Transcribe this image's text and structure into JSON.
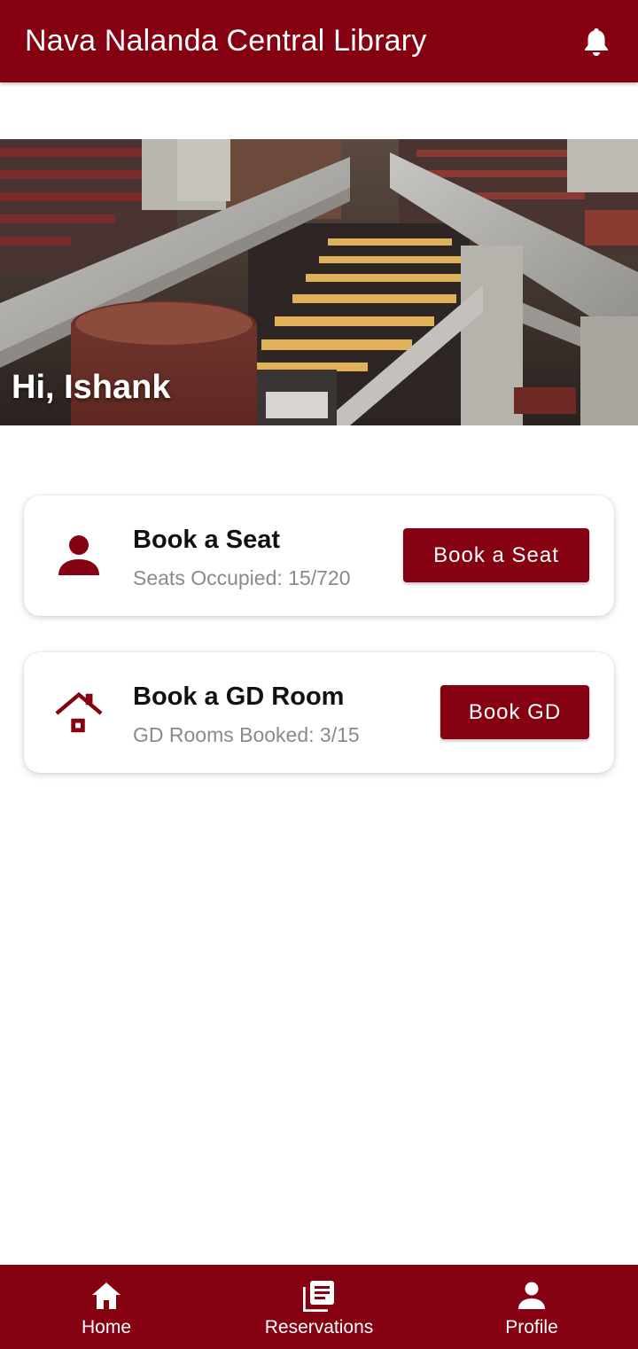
{
  "appbar": {
    "title": "Nava Nalanda Central Library",
    "icon": "bell-icon"
  },
  "hero": {
    "greeting": "Hi, Ishank"
  },
  "cards": {
    "seat": {
      "icon": "person-icon",
      "title": "Book a Seat",
      "subtitle": "Seats Occupied: 15/720",
      "button_label": "Book a Seat"
    },
    "gd": {
      "icon": "house-icon",
      "title": "Book a GD Room",
      "subtitle": "GD Rooms Booked: 3/15",
      "button_label": "Book GD"
    }
  },
  "bottom_nav": {
    "items": [
      {
        "label": "Home",
        "icon": "home-icon"
      },
      {
        "label": "Reservations",
        "icon": "reservations-icon"
      },
      {
        "label": "Profile",
        "icon": "profile-icon"
      }
    ]
  },
  "colors": {
    "primary": "#850010",
    "background": "#ffffff",
    "subtitle_text": "#8a8a8a"
  }
}
